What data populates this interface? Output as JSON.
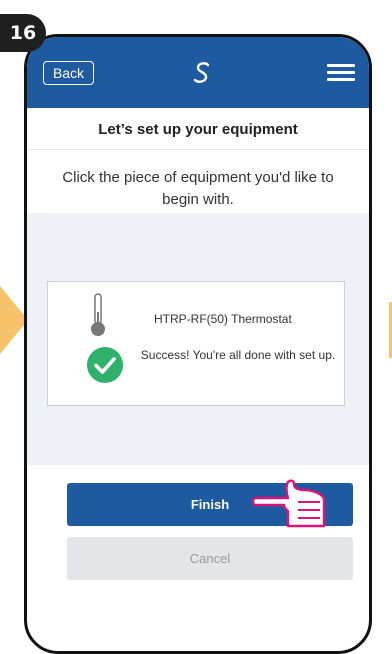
{
  "step": {
    "number": "16"
  },
  "header": {
    "back_label": "Back",
    "logo_icon": "salus-logo-icon",
    "menu_icon": "hamburger-menu-icon",
    "color": "#1e5aa0"
  },
  "page": {
    "title": "Let’s set up your equipment",
    "instructions": "Click the piece of equipment you'd like to begin with."
  },
  "device": {
    "name": "HTRP-RF(50) Thermostat",
    "status": "Success! You're all done with set up.",
    "icon": "thermometer-icon",
    "status_icon": "check-circle-icon",
    "status_color": "#2fb06b"
  },
  "actions": {
    "finish_label": "Finish",
    "cancel_label": "Cancel"
  },
  "annotation": {
    "pointer_icon": "pointing-hand-icon",
    "pointer_color": "#e0127a",
    "arrow_color": "#f6c26a"
  }
}
